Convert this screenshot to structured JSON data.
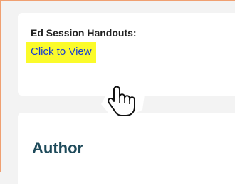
{
  "handouts": {
    "title": "Ed Session Handouts:",
    "link_text": "Click to View"
  },
  "author_section": {
    "heading": "Author"
  },
  "cursor": {
    "icon": "hand-pointer-icon"
  },
  "colors": {
    "frame_border": "#f0a071",
    "highlight": "#fbfb2a",
    "link": "#1a3fd1",
    "heading": "#1e4a5a"
  }
}
